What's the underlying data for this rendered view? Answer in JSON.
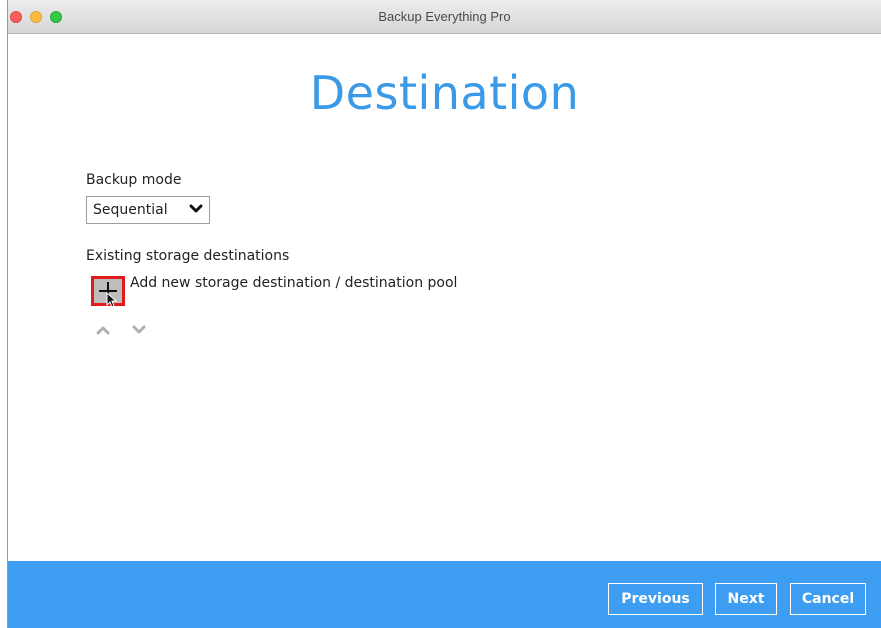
{
  "window": {
    "title": "Backup Everything Pro"
  },
  "page": {
    "title": "Destination"
  },
  "backup_mode": {
    "label": "Backup mode",
    "selected": "Sequential",
    "icon": "chevron-down-icon"
  },
  "destinations": {
    "label": "Existing storage destinations",
    "add_label": "Add new storage destination / destination pool",
    "add_icon": "plus-icon",
    "move_up_icon": "chevron-up-icon",
    "move_down_icon": "chevron-down-icon"
  },
  "footer": {
    "previous_label": "Previous",
    "next_label": "Next",
    "cancel_label": "Cancel"
  },
  "colors": {
    "accent": "#3a9ae8",
    "footer_bg": "#3d9df0",
    "highlight": "#e01b1b"
  }
}
